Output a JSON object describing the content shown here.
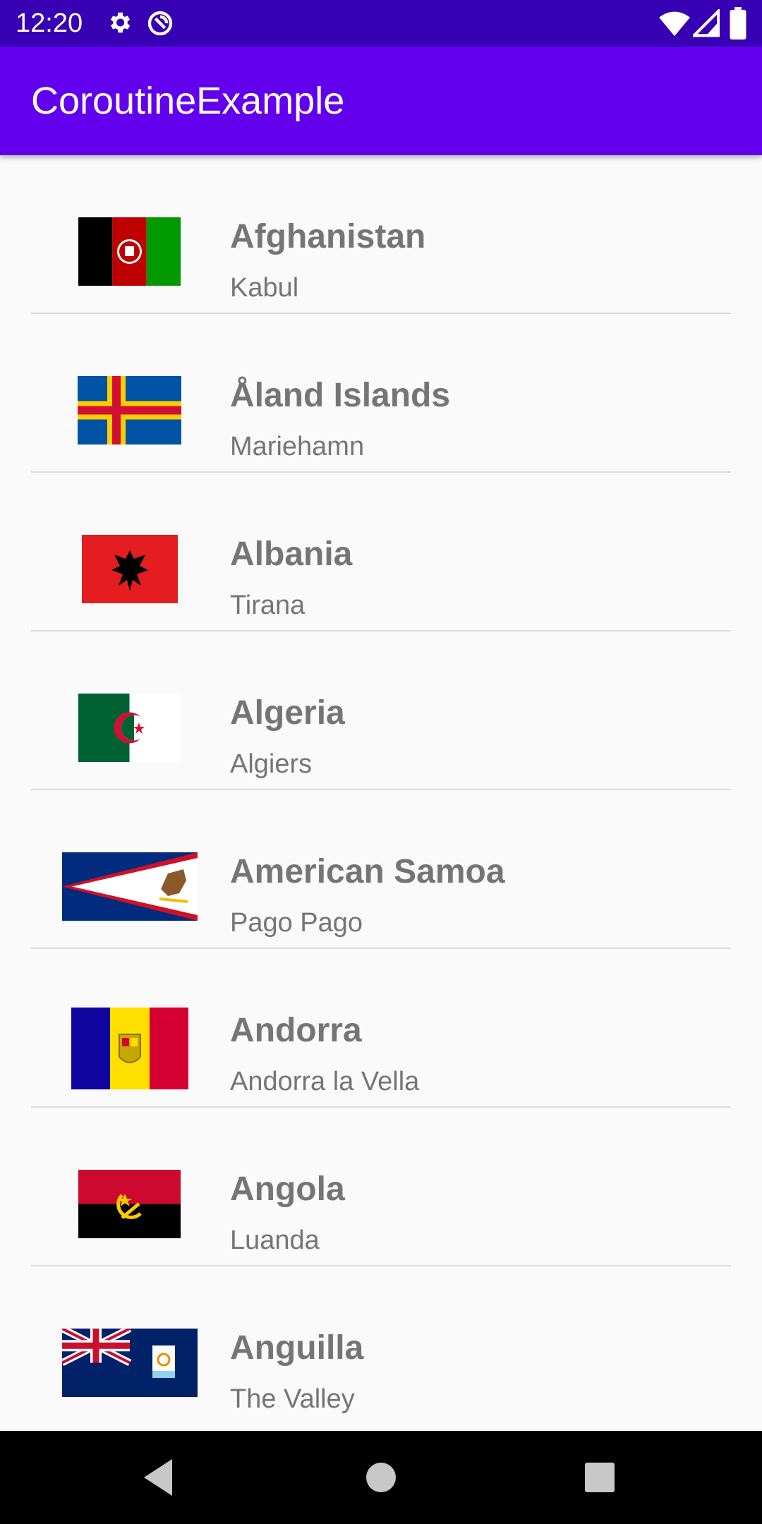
{
  "status_bar": {
    "time": "12:20",
    "icons": [
      "gear-icon",
      "data-saver-icon",
      "wifi-icon",
      "signal-icon",
      "battery-icon"
    ]
  },
  "app_bar": {
    "title": "CoroutineExample"
  },
  "countries": [
    {
      "name": "Afghanistan",
      "capital": "Kabul",
      "flag": "flag-afghanistan"
    },
    {
      "name": "Åland Islands",
      "capital": "Mariehamn",
      "flag": "flag-aland-islands"
    },
    {
      "name": "Albania",
      "capital": "Tirana",
      "flag": "flag-albania"
    },
    {
      "name": "Algeria",
      "capital": "Algiers",
      "flag": "flag-algeria"
    },
    {
      "name": "American Samoa",
      "capital": "Pago Pago",
      "flag": "flag-american-samoa"
    },
    {
      "name": "Andorra",
      "capital": "Andorra la Vella",
      "flag": "flag-andorra"
    },
    {
      "name": "Angola",
      "capital": "Luanda",
      "flag": "flag-angola"
    },
    {
      "name": "Anguilla",
      "capital": "The Valley",
      "flag": "flag-anguilla"
    }
  ],
  "nav_bar": {
    "buttons": [
      "back-icon",
      "home-icon",
      "recents-icon"
    ]
  },
  "colors": {
    "status_bar": "#3700b3",
    "app_bar": "#6200ee",
    "text_gray": "#757575",
    "nav_bar": "#000000"
  }
}
